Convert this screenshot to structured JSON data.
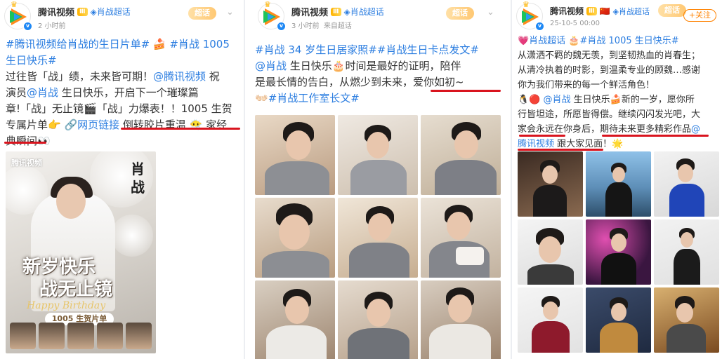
{
  "posts": [
    {
      "author": "腾讯视频",
      "level": "Ⅲ",
      "topic": "肖战超话",
      "topic_badge": "超话",
      "time": "2 小时前",
      "lines": [
        {
          "parts": [
            {
              "t": "#腾讯视频给肖战的生日片单#",
              "link": true
            },
            {
              "t": " 🍰 ",
              "link": false
            },
            {
              "t": "#肖战 1005",
              "link": true
            }
          ]
        },
        {
          "parts": [
            {
              "t": "生日快乐#",
              "link": true
            }
          ]
        },
        {
          "parts": [
            {
              "t": "过往皆「战」绩，未来皆可期！",
              "link": false
            },
            {
              "t": "@腾讯视频",
              "link": true
            },
            {
              "t": " 祝",
              "link": false
            }
          ]
        },
        {
          "parts": [
            {
              "t": "演员",
              "link": false
            },
            {
              "t": "@肖战",
              "link": true
            },
            {
              "t": " 生日快乐，开启下一个璀璨篇",
              "link": false
            }
          ]
        },
        {
          "parts": [
            {
              "t": "章!「战」无止镜🎬「战」力爆表！！1005 生贺",
              "link": false
            }
          ]
        },
        {
          "parts": [
            {
              "t": "专属片单👉 ",
              "link": false
            },
            {
              "t": "🔗网页链接",
              "link": true
            },
            {
              "t": " 倒转胶片重温 😶‍🌫️ 家经",
              "link": false
            }
          ]
        },
        {
          "parts": [
            {
              "t": "典瞬间👀",
              "link": false
            }
          ]
        }
      ],
      "poster": {
        "brand": "腾讯视频",
        "name": "肖战",
        "title_line1": "新岁快乐",
        "title_line2": "战无止镜",
        "script_text": "Happy Birthday",
        "ribbon": "1005 生贺片单"
      }
    },
    {
      "author": "腾讯视频",
      "level": "Ⅲ",
      "topic": "肖战超话",
      "topic_badge": "超话",
      "time": "3 小时前",
      "source": "来自超话",
      "lines": [
        {
          "parts": [
            {
              "t": "#肖战 34 岁生日居家照##肖战生日卡点发文#",
              "link": true
            }
          ]
        },
        {
          "parts": [
            {
              "t": "@肖战",
              "link": true
            },
            {
              "t": " 生日快乐🎂时间是最好的证明，陪伴",
              "link": false
            }
          ]
        },
        {
          "parts": [
            {
              "t": "是最长情的告白，从燃少到未来，爱你如初~",
              "link": false
            }
          ]
        },
        {
          "parts": [
            {
              "t": "👐🏻",
              "link": false
            },
            {
              "t": "#肖战工作室长文#",
              "link": true
            }
          ]
        }
      ]
    },
    {
      "author": "腾讯视频",
      "level": "Ⅲ",
      "flag": "🇨🇳",
      "topic": "肖战超话",
      "topic_badge": "超话",
      "time": "25-10-5 00:00",
      "follow_label": "+关注",
      "lines": [
        {
          "parts": [
            {
              "t": "💗肖战超话 🎂#肖战 1005 生日快乐#",
              "link": true
            }
          ]
        },
        {
          "parts": [
            {
              "t": "从潇洒不羁的魏无羡，到坚韧热血的肖春生；",
              "link": false
            }
          ]
        },
        {
          "parts": [
            {
              "t": "从清冷执着的时影，到温柔专业的顾魏…感谢",
              "link": false
            }
          ]
        },
        {
          "parts": [
            {
              "t": "你为我们带来的每一个鲜活角色！",
              "link": false
            }
          ]
        },
        {
          "parts": [
            {
              "t": "🐧🔴 ",
              "link": false
            },
            {
              "t": "@肖战",
              "link": true
            },
            {
              "t": " 生日快乐🍰新的一岁，愿你所",
              "link": false
            }
          ]
        },
        {
          "parts": [
            {
              "t": "行皆坦途，所愿皆得偿。继续闪闪发光吧，大",
              "link": false
            }
          ]
        },
        {
          "parts": [
            {
              "t": "家会永远在你身后，期待未来更多精彩作品",
              "link": false
            },
            {
              "t": "@",
              "link": true
            }
          ]
        },
        {
          "parts": [
            {
              "t": "腾讯视频",
              "link": true
            },
            {
              "t": " 跟大家见面！🌟",
              "link": false
            }
          ]
        }
      ]
    }
  ],
  "colors": {
    "link": "#2b7de0",
    "underline": "#d9141e",
    "follow": "#ff8200",
    "verified": "#1e88f5"
  },
  "icons": [
    "tencent-video-logo-icon",
    "verified-icon",
    "crown-icon",
    "chevron-down-icon",
    "diamond-topic-icon"
  ]
}
